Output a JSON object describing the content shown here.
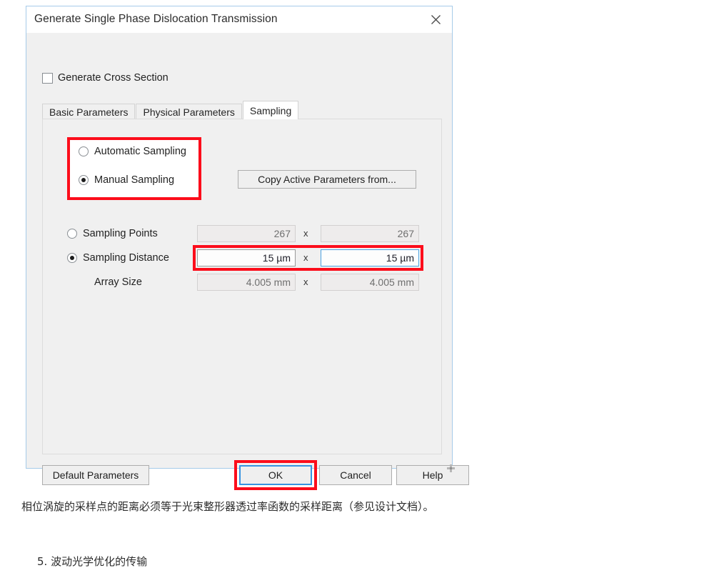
{
  "dialog": {
    "title": "Generate Single Phase Dislocation Transmission",
    "close_icon": "close-icon",
    "checkbox": {
      "label": "Generate Cross Section",
      "checked": false
    },
    "tabs": [
      {
        "label": "Basic Parameters",
        "active": false
      },
      {
        "label": "Physical Parameters",
        "active": false
      },
      {
        "label": "Sampling",
        "active": true
      }
    ],
    "sampling_mode": {
      "options": [
        {
          "label": "Automatic Sampling",
          "selected": false
        },
        {
          "label": "Manual Sampling",
          "selected": true
        }
      ]
    },
    "copy_button": {
      "label": "Copy Active Parameters from..."
    },
    "rows": [
      {
        "label": "Sampling Points",
        "radio": true,
        "selected": false,
        "x_separator": "x",
        "value_x": "267",
        "value_y": "267",
        "state": "disabled"
      },
      {
        "label": "Sampling Distance",
        "radio": true,
        "selected": true,
        "x_separator": "x",
        "value_x": "15 µm",
        "value_y": "15 µm",
        "state": "enabled"
      },
      {
        "label": "Array Size",
        "radio": false,
        "selected": false,
        "x_separator": "x",
        "value_x": "4.005 mm",
        "value_y": "4.005 mm",
        "state": "disabled"
      }
    ],
    "buttons": [
      {
        "label": "Default Parameters",
        "focused": false,
        "annotated": false
      },
      {
        "label": "OK",
        "focused": true,
        "annotated": true
      },
      {
        "label": "Cancel",
        "focused": false,
        "annotated": false
      },
      {
        "label": "Help",
        "focused": false,
        "annotated": false
      }
    ]
  },
  "annotations": {
    "color": "#fc0d1b",
    "boxes": [
      "sampling-mode-group",
      "sampling-distance-fields",
      "ok-button"
    ]
  },
  "document": {
    "paragraph_1": "相位涡旋的采样点的距离必须等于光束整形器透过率函数的采样距离（参见设计文档）。",
    "paragraph_2": "5. 波动光学优化的传输"
  }
}
